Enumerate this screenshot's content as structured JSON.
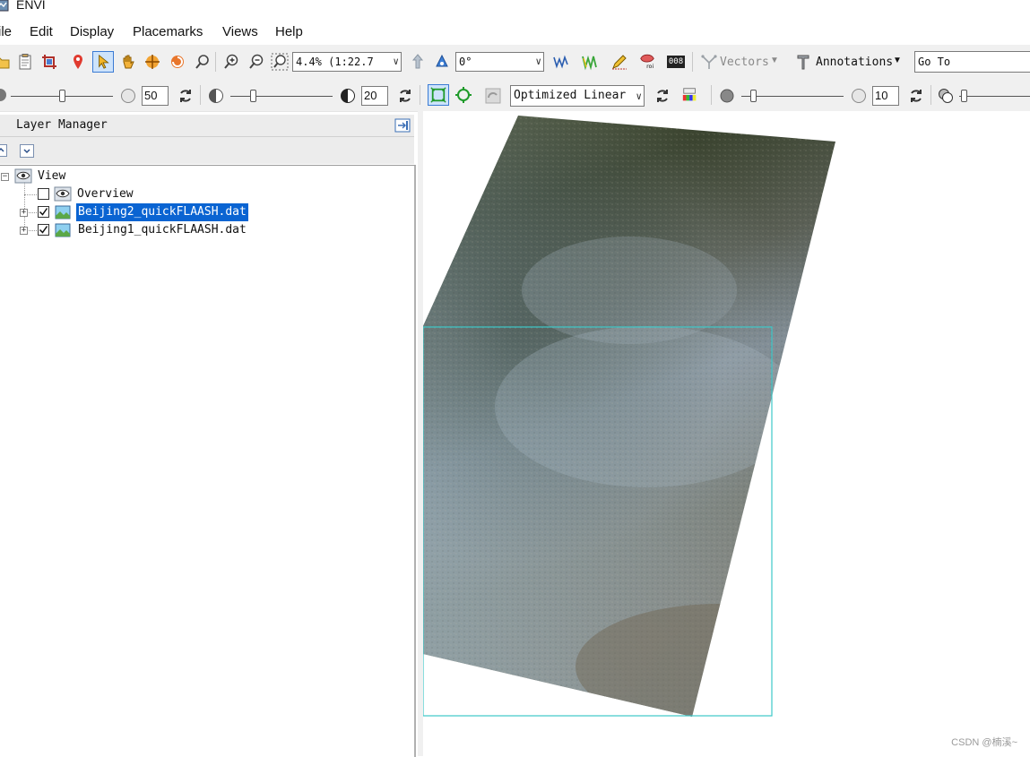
{
  "window": {
    "title": "ENVI"
  },
  "menu": {
    "items": [
      "ile",
      "Edit",
      "Display",
      "Placemarks",
      "Views",
      "Help"
    ]
  },
  "toolbar1": {
    "zoom_value": "4.4% (1:22.7",
    "rotation_value": "0°",
    "vectors_label": "Vectors",
    "annotations_label": "Annotations",
    "goto_value": "Go To",
    "roi_badge": "roi",
    "data_badge": "008"
  },
  "toolbar2": {
    "brightness_value": "50",
    "contrast_value": "20",
    "stretch_value": "Optimized Linear",
    "sharpen_value": "10"
  },
  "layer_manager": {
    "title": "Layer Manager",
    "tree": {
      "root": "View",
      "items": [
        {
          "label": "Overview",
          "checked": false,
          "selected": false
        },
        {
          "label": "Beijing2_quickFLAASH.dat",
          "checked": true,
          "selected": true
        },
        {
          "label": "Beijing1_quickFLAASH.dat",
          "checked": true,
          "selected": false
        }
      ]
    }
  },
  "watermark": "CSDN @楠溪~",
  "colors": {
    "selection": "#0a64d2",
    "overview_box": "#3cc8c8",
    "toolbar_bg": "#f0f0f0"
  }
}
